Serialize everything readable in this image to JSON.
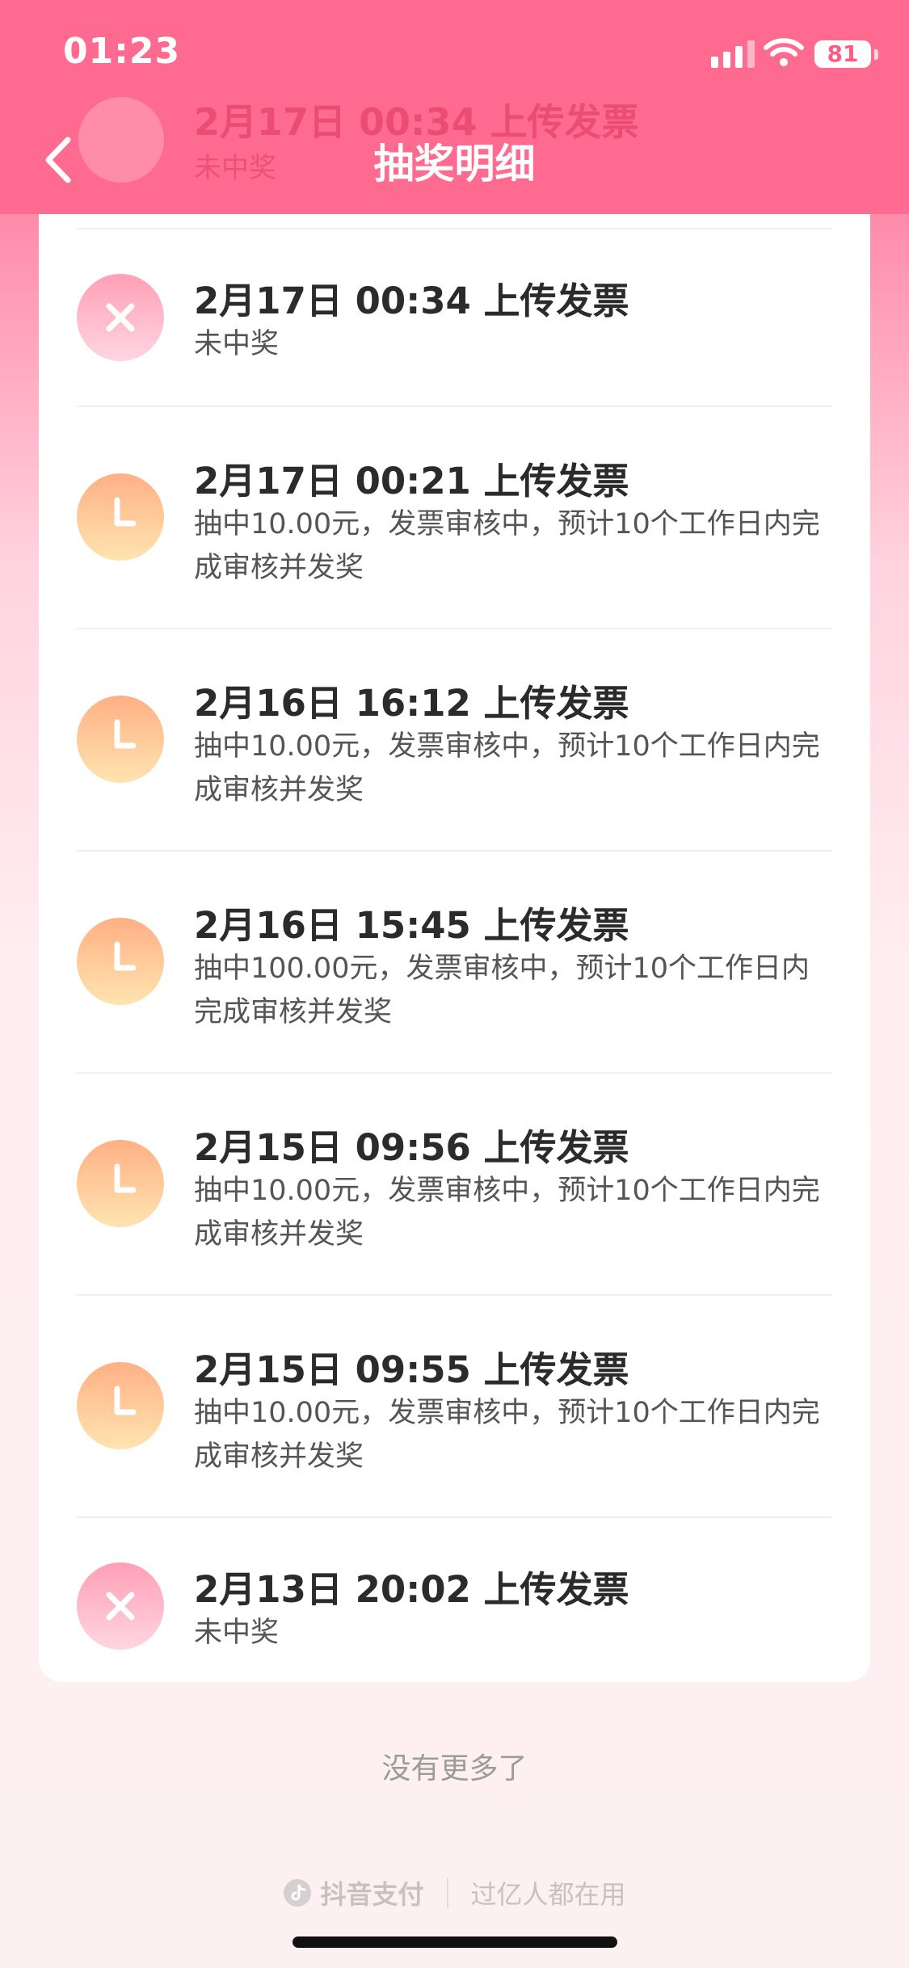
{
  "status_bar": {
    "time": "01:23",
    "battery": "81"
  },
  "nav": {
    "title": "抽奖明细",
    "scrolled_entry": {
      "title": "2月17日 00:34 上传发票",
      "desc": "未中奖"
    }
  },
  "records": [
    {
      "status": "lose",
      "title": "2月17日 00:34 上传发票",
      "desc": "未中奖"
    },
    {
      "status": "pending",
      "title": "2月17日 00:21 上传发票",
      "desc": "抽中10.00元，发票审核中，预计10个工作日内完成审核并发奖"
    },
    {
      "status": "pending",
      "title": "2月16日 16:12 上传发票",
      "desc": "抽中10.00元，发票审核中，预计10个工作日内完成审核并发奖"
    },
    {
      "status": "pending",
      "title": "2月16日 15:45 上传发票",
      "desc": "抽中100.00元，发票审核中，预计10个工作日内完成审核并发奖"
    },
    {
      "status": "pending",
      "title": "2月15日 09:56 上传发票",
      "desc": "抽中10.00元，发票审核中，预计10个工作日内完成审核并发奖"
    },
    {
      "status": "pending",
      "title": "2月15日 09:55 上传发票",
      "desc": "抽中10.00元，发票审核中，预计10个工作日内完成审核并发奖"
    },
    {
      "status": "lose",
      "title": "2月13日 20:02 上传发票",
      "desc": "未中奖"
    }
  ],
  "list_end_text": "没有更多了",
  "footer": {
    "brand": "抖音支付",
    "slogan": "过亿人都在用"
  }
}
